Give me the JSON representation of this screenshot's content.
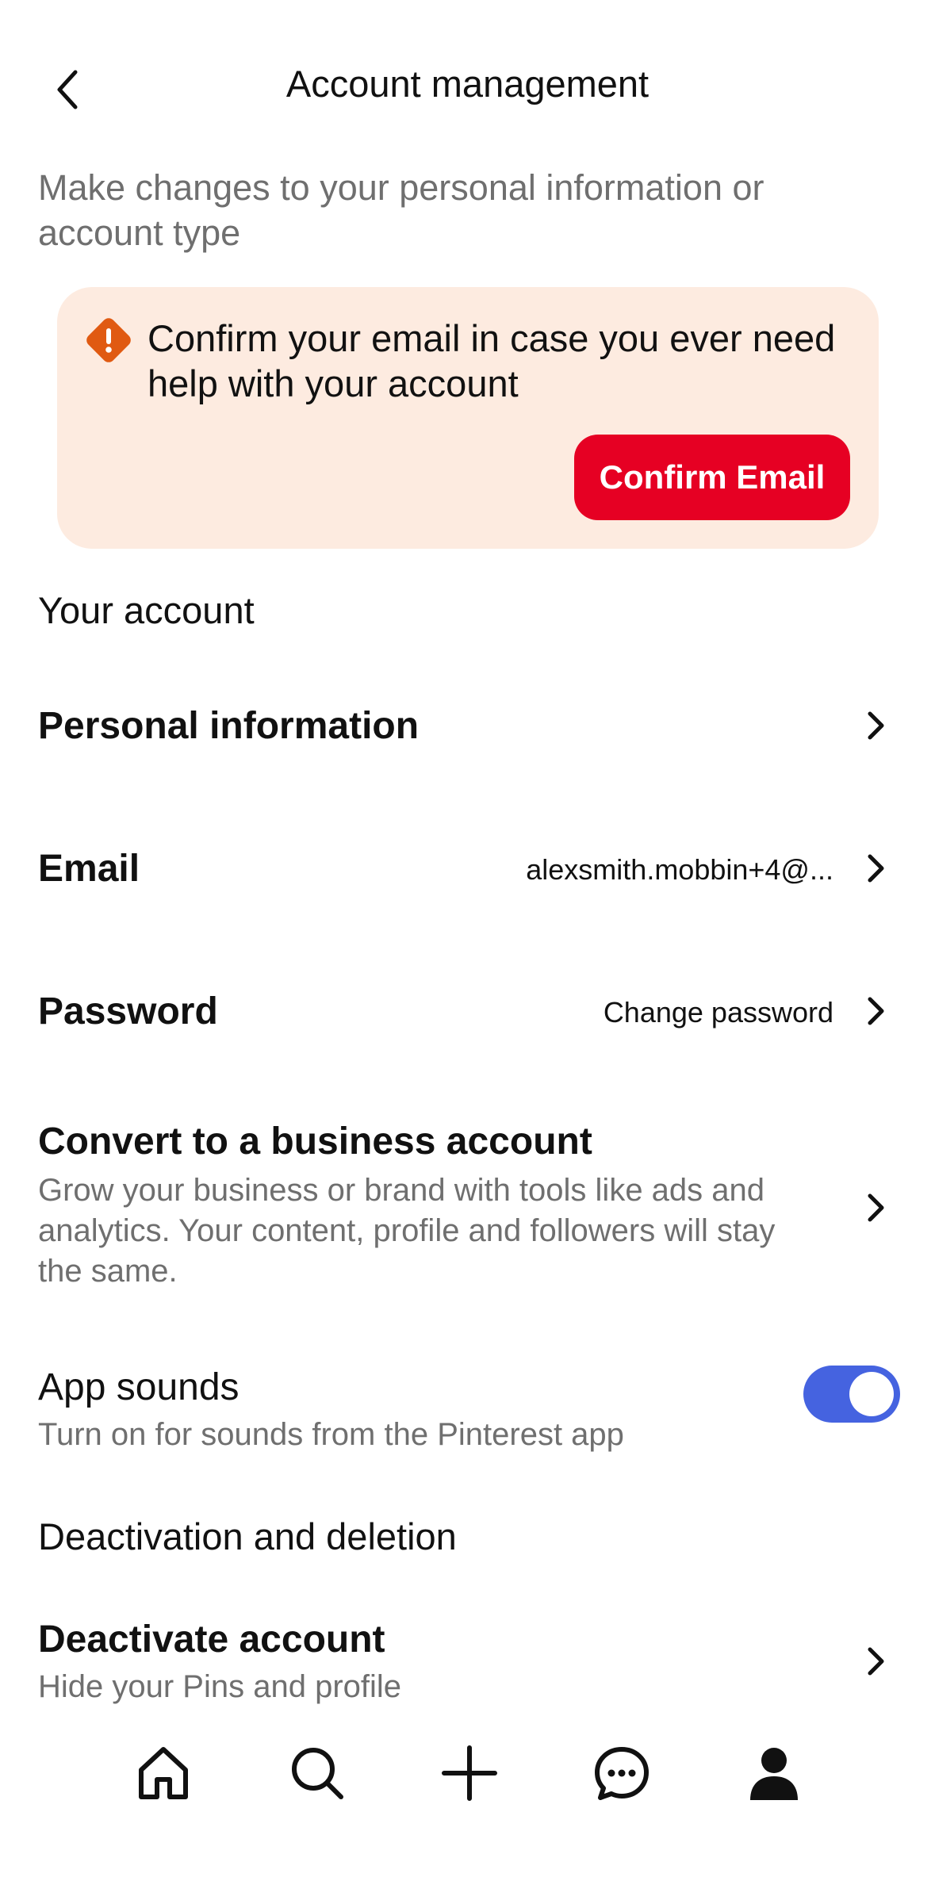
{
  "header": {
    "title": "Account management"
  },
  "subtitle": "Make changes to your personal information or account type",
  "banner": {
    "message": "Confirm your email in case you ever need help with your account",
    "button_label": "Confirm Email",
    "accent_color": "#e60023",
    "warning_color": "#e05a12",
    "background_color": "#fdebe0"
  },
  "your_account": {
    "heading": "Your account",
    "personal_info": {
      "title": "Personal information"
    },
    "email": {
      "title": "Email",
      "value": "alexsmith.mobbin+4@..."
    },
    "password": {
      "title": "Password",
      "value": "Change password"
    },
    "business": {
      "title": "Convert to a business account",
      "description": "Grow your business or brand with tools like ads and analytics. Your content, profile and followers will stay the same."
    },
    "app_sounds": {
      "title": "App sounds",
      "description": "Turn on for sounds from the Pinterest app",
      "enabled": true,
      "toggle_color": "#4563e0"
    }
  },
  "deactivation": {
    "heading": "Deactivation and deletion",
    "deactivate": {
      "title": "Deactivate account",
      "description": "Hide your Pins and profile"
    }
  },
  "bottom_nav": {
    "items": [
      "home-icon",
      "search-icon",
      "create-plus-icon",
      "messages-icon",
      "profile-icon"
    ]
  }
}
